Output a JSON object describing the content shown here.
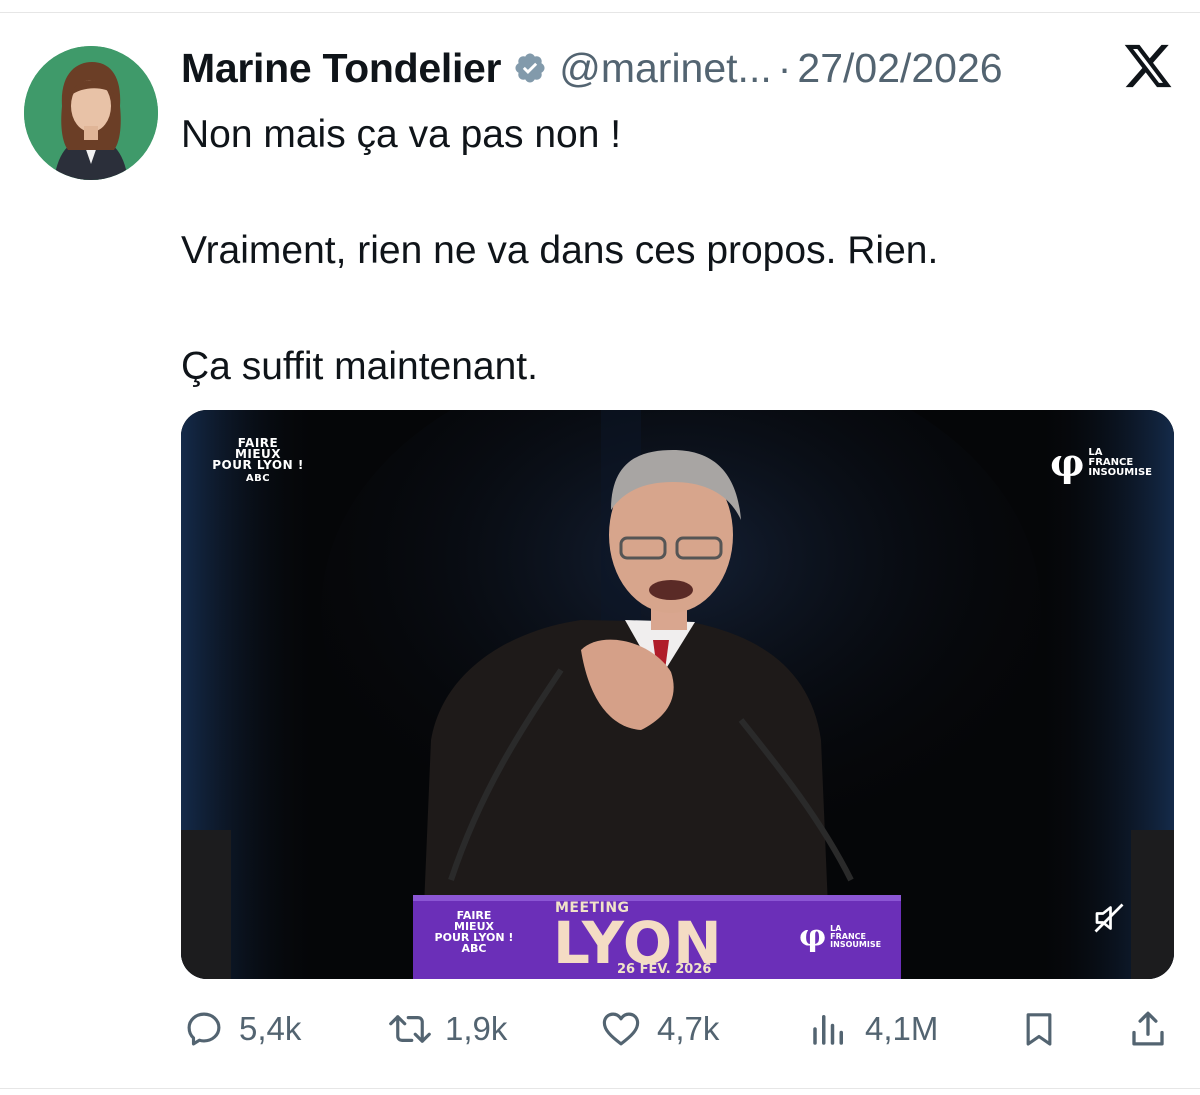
{
  "tweet": {
    "author": {
      "display_name": "Marine Tondelier",
      "handle": "@marinet...",
      "separator": "·",
      "timestamp": "27/02/2026"
    },
    "text_lines": [
      "Non mais ça va pas non !",
      "Vraiment, rien ne va dans ces propos. Rien.",
      "Ça suffit maintenant."
    ],
    "media": {
      "top_left_brand": [
        "FAIRE",
        "MIEUX",
        "POUR LYON !",
        "ABC"
      ],
      "top_right_brand": [
        "LA",
        "FRANCE",
        "INSOUMISE"
      ],
      "podium_left_brand": [
        "FAIRE",
        "MIEUX",
        "POUR LYON !",
        "ABC"
      ],
      "podium_meeting": "MEETING",
      "podium_city": "LYON",
      "podium_date": "26 FÉV. 2026",
      "lfi_symbol": "φ",
      "muted": true
    },
    "actions": {
      "replies": "5,4k",
      "reposts": "1,9k",
      "likes": "4,7k",
      "views": "4,1M"
    }
  },
  "colors": {
    "text": "#0f1419",
    "secondary": "#536471",
    "verified": "#829aab",
    "avatar_bg": "#3f9a6a",
    "podium": "#6b2fb8"
  },
  "icons": [
    "verified-badge-icon",
    "x-logo-icon",
    "mute-icon",
    "reply-icon",
    "repost-icon",
    "like-icon",
    "views-icon",
    "bookmark-icon",
    "share-icon"
  ]
}
